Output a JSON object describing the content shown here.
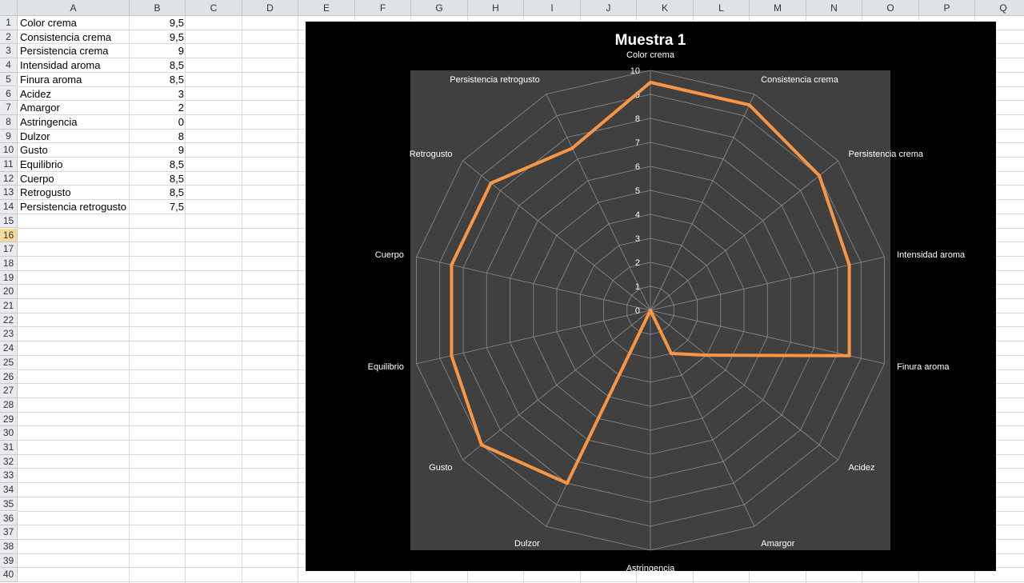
{
  "spreadsheet": {
    "columns": [
      "A",
      "B",
      "C",
      "D",
      "E",
      "F",
      "G",
      "H",
      "I",
      "J",
      "K",
      "L",
      "M",
      "N",
      "O",
      "P",
      "Q"
    ],
    "rows": [
      "1",
      "2",
      "3",
      "4",
      "5",
      "6",
      "7",
      "8",
      "9",
      "10",
      "11",
      "12",
      "13",
      "14",
      "15",
      "16",
      "17",
      "18",
      "19",
      "20",
      "21",
      "22",
      "23",
      "24",
      "25",
      "26",
      "27",
      "28",
      "29",
      "30",
      "31",
      "32",
      "33",
      "34",
      "35",
      "36",
      "37",
      "38",
      "39",
      "40"
    ],
    "active_row": "16",
    "data_rows": [
      {
        "label": "Color crema",
        "value": "9,5"
      },
      {
        "label": "Consistencia crema",
        "value": "9,5"
      },
      {
        "label": "Persistencia crema",
        "value": "9"
      },
      {
        "label": "Intensidad aroma",
        "value": "8,5"
      },
      {
        "label": "Finura aroma",
        "value": "8,5"
      },
      {
        "label": "Acidez",
        "value": "3"
      },
      {
        "label": "Amargor",
        "value": "2"
      },
      {
        "label": "Astringencia",
        "value": "0"
      },
      {
        "label": "Dulzor",
        "value": "8"
      },
      {
        "label": "Gusto",
        "value": "9"
      },
      {
        "label": "Equilibrio",
        "value": "8,5"
      },
      {
        "label": "Cuerpo",
        "value": "8,5"
      },
      {
        "label": "Retrogusto",
        "value": "8,5"
      },
      {
        "label": "Persistencia retrogusto",
        "value": "7,5"
      }
    ]
  },
  "chart_data": {
    "type": "radar",
    "title": "Muestra 1",
    "categories": [
      "Color crema",
      "Consistencia crema",
      "Persistencia crema",
      "Intensidad aroma",
      "Finura aroma",
      "Acidez",
      "Amargor",
      "Astringencia",
      "Dulzor",
      "Gusto",
      "Equilibrio",
      "Cuerpo",
      "Retrogusto",
      "Persistencia retrogusto"
    ],
    "series": [
      {
        "values": [
          9.5,
          9.5,
          9,
          8.5,
          8.5,
          3,
          2,
          0,
          8,
          9,
          8.5,
          8.5,
          8.5,
          7.5
        ]
      }
    ],
    "rlim": [
      0,
      10
    ],
    "ticks": [
      "0",
      "1",
      "2",
      "3",
      "4",
      "5",
      "6",
      "7",
      "8",
      "9",
      "10"
    ],
    "grid": true,
    "legend": "none",
    "colors": {
      "series": "#f79646",
      "plot_bg": "#404040",
      "chart_bg": "#000000",
      "grid": "#8c8c8c",
      "text": "#ffffff"
    }
  }
}
